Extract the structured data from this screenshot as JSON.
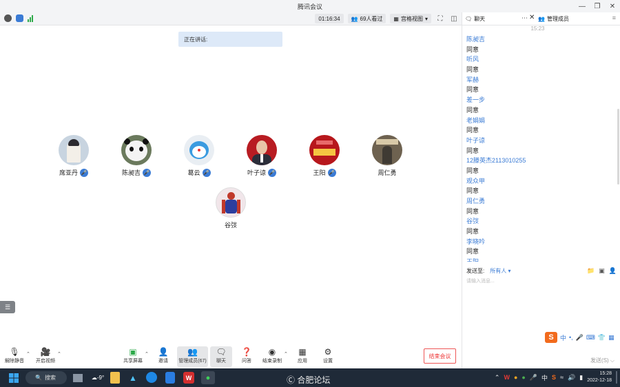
{
  "window": {
    "title": "腾讯会议"
  },
  "infobar": {
    "duration": "01:16:34",
    "watchers": "69人看过",
    "view_mode": "宫格视图"
  },
  "stage": {
    "speaking_label": "正在讲话:",
    "participants": [
      {
        "name": "席亚丹",
        "mic": true
      },
      {
        "name": "陈昶吉",
        "mic": true
      },
      {
        "name": "葛云",
        "mic": true
      },
      {
        "name": "叶子谅",
        "mic": true
      },
      {
        "name": "王阳",
        "mic": true
      },
      {
        "name": "周仁勇",
        "mic": false
      },
      {
        "name": "谷弢",
        "mic": false
      }
    ]
  },
  "toolbar": {
    "unmute": "解除静音",
    "video": "开启视频",
    "share": "共享屏幕",
    "invite": "邀请",
    "manage": "管理成员(67)",
    "chat": "聊天",
    "qa": "问答",
    "record": "结束录制",
    "apps": "应用",
    "settings": "设置",
    "end": "结束会议"
  },
  "chat": {
    "tab_chat": "聊天",
    "tab_members": "管理成员",
    "time": "15:23",
    "messages": [
      {
        "name": "陈昶吉",
        "text": "同意"
      },
      {
        "name": "听风",
        "text": "同意"
      },
      {
        "name": "军赫",
        "text": "同意"
      },
      {
        "name": "差一步",
        "text": "同意"
      },
      {
        "name": "老娟娟",
        "text": "同意"
      },
      {
        "name": "叶子谅",
        "text": "同意"
      },
      {
        "name": "12滕英杰2113010255",
        "text": "同意"
      },
      {
        "name": "观众甲",
        "text": "同意"
      },
      {
        "name": "周仁勇",
        "text": "同意"
      },
      {
        "name": "谷弢",
        "text": "同意"
      },
      {
        "name": "李晓吟",
        "text": "同意"
      },
      {
        "name": "王阳",
        "text": ""
      }
    ],
    "send_to_label": "发送至:",
    "send_to_value": "所有人",
    "input_placeholder": "请输入消息...",
    "ime_label": "中",
    "send_button": "发送(S)"
  },
  "taskbar": {
    "search": "搜索",
    "weather": "-9°",
    "watermark": "合肥论坛",
    "ime": "中",
    "time": "15:28",
    "date": "2022-12-18"
  },
  "colors": {
    "accent": "#3a7bd5",
    "end": "#e33333",
    "taskbar": "#1f2a38"
  }
}
